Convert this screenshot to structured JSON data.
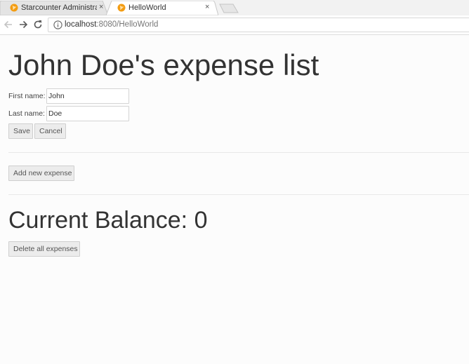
{
  "browser": {
    "tabs": [
      {
        "title": "Starcounter Administrato",
        "active": false
      },
      {
        "title": "HelloWorld",
        "active": true
      }
    ],
    "close_glyph": "×",
    "address": {
      "host": "localhost",
      "path": ":8080/HelloWorld"
    },
    "icons": {
      "back": "arrow-left-icon",
      "forward": "arrow-right-icon",
      "reload": "reload-icon",
      "info": "info-icon",
      "favicon": "starcounter-favicon-icon"
    },
    "accent_color": "#f39c12"
  },
  "page": {
    "heading": "John Doe's expense list",
    "first_name": {
      "label": "First name:",
      "value": "John"
    },
    "last_name": {
      "label": "Last name:",
      "value": "Doe"
    },
    "save_label": "Save",
    "cancel_label": "Cancel",
    "add_expense_label": "Add new expense",
    "balance_text": "Current Balance: 0",
    "delete_all_label": "Delete all expenses"
  }
}
